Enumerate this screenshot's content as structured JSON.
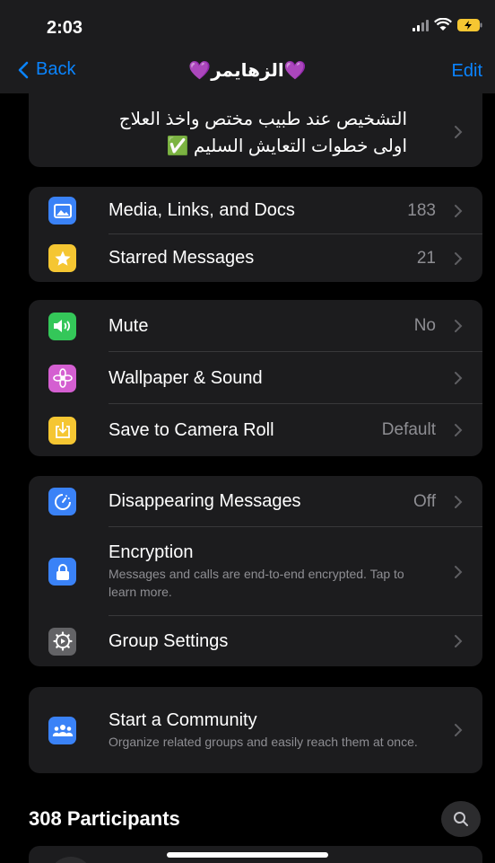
{
  "status_bar": {
    "time": "2:03"
  },
  "nav": {
    "back_label": "Back",
    "title": "💜الزهايمر💜",
    "edit_label": "Edit"
  },
  "description": {
    "line1": "التشخيص عند طبيب مختص واخذ العلاج",
    "line2": "اولى خطوات التعايش السليم ✅"
  },
  "media_card": {
    "media": {
      "label": "Media, Links, and Docs",
      "value": "183",
      "icon": "photo-icon",
      "color": "#3a82f7"
    },
    "starred": {
      "label": "Starred Messages",
      "value": "21",
      "icon": "star-icon",
      "color": "#f5c632"
    }
  },
  "settings_card": {
    "mute": {
      "label": "Mute",
      "value": "No",
      "icon": "speaker-icon",
      "color": "#34c759"
    },
    "wallpaper": {
      "label": "Wallpaper & Sound",
      "value": "",
      "icon": "flower-icon",
      "color": "#d45fd1"
    },
    "camera_roll": {
      "label": "Save to Camera Roll",
      "value": "Default",
      "icon": "download-icon",
      "color": "#f5c632"
    }
  },
  "privacy_card": {
    "disappearing": {
      "label": "Disappearing Messages",
      "value": "Off",
      "icon": "timer-icon",
      "color": "#3a82f7"
    },
    "encryption": {
      "label": "Encryption",
      "sub": "Messages and calls are end-to-end encrypted. Tap to learn more.",
      "icon": "lock-icon",
      "color": "#3a82f7"
    },
    "group_settings": {
      "label": "Group Settings",
      "icon": "gear-icon",
      "color": "#636366"
    }
  },
  "community_card": {
    "label": "Start a Community",
    "sub": "Organize related groups and easily reach them at once.",
    "icon": "community-icon",
    "color": "#3a82f7"
  },
  "participants": {
    "header": "308 Participants"
  }
}
